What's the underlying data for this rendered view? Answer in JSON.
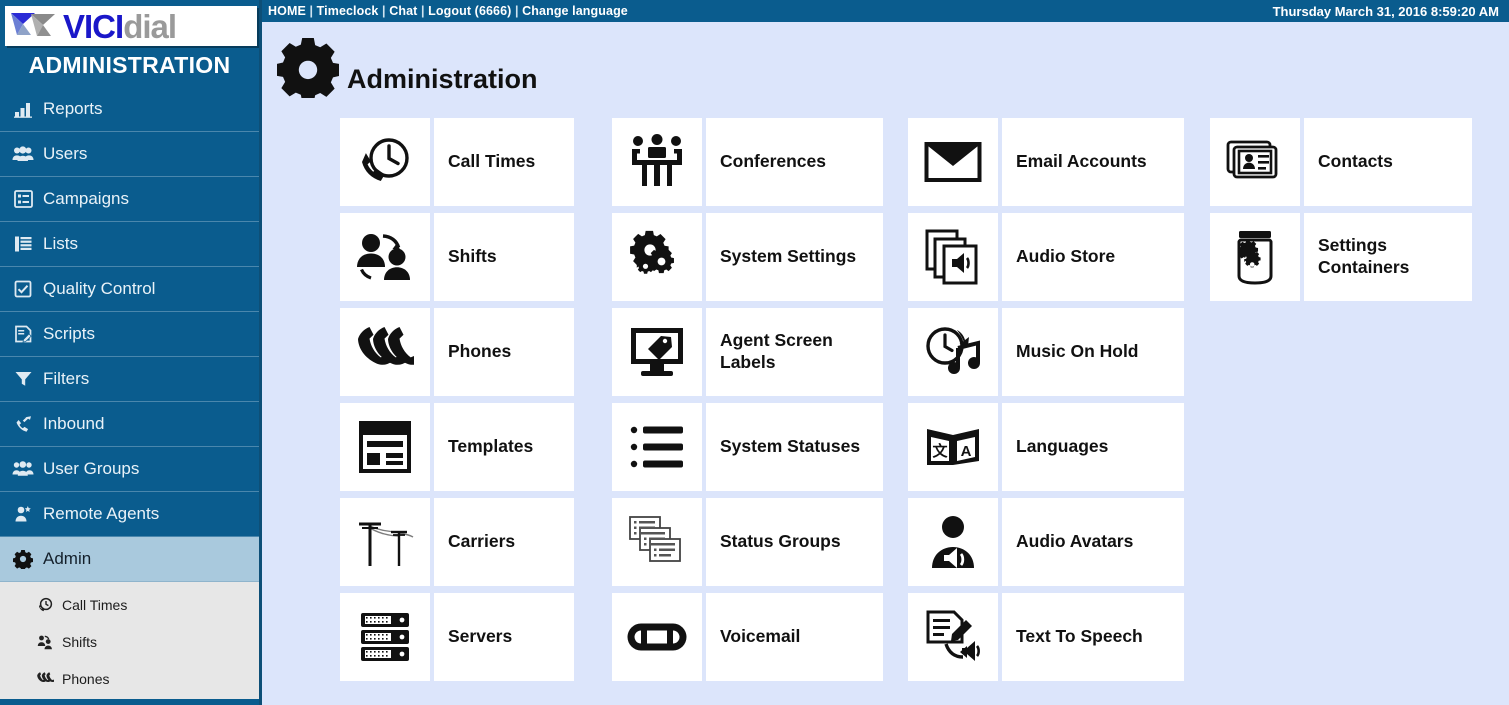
{
  "topbar": {
    "links": [
      "HOME",
      "Timeclock",
      "Chat",
      "Logout (6666)",
      "Change language"
    ],
    "separator": "|",
    "datetime": "Thursday March 31, 2016 8:59:20 AM"
  },
  "sidebar": {
    "logo": {
      "part1": "VICI",
      "part2": "dial",
      "icon": "vicidial-logo-icon"
    },
    "title": "ADMINISTRATION",
    "items": [
      {
        "label": "Reports",
        "icon": "reports-icon",
        "active": false
      },
      {
        "label": "Users",
        "icon": "users-icon",
        "active": false
      },
      {
        "label": "Campaigns",
        "icon": "campaigns-icon",
        "active": false
      },
      {
        "label": "Lists",
        "icon": "lists-icon",
        "active": false
      },
      {
        "label": "Quality Control",
        "icon": "quality-control-icon",
        "active": false
      },
      {
        "label": "Scripts",
        "icon": "scripts-icon",
        "active": false
      },
      {
        "label": "Filters",
        "icon": "filters-icon",
        "active": false
      },
      {
        "label": "Inbound",
        "icon": "inbound-icon",
        "active": false
      },
      {
        "label": "User Groups",
        "icon": "user-groups-icon",
        "active": false
      },
      {
        "label": "Remote Agents",
        "icon": "remote-agents-icon",
        "active": false
      },
      {
        "label": "Admin",
        "icon": "admin-gear-icon",
        "active": true
      }
    ],
    "submenu": [
      {
        "label": "Call Times",
        "icon": "call-times-icon"
      },
      {
        "label": "Shifts",
        "icon": "shifts-icon"
      },
      {
        "label": "Phones",
        "icon": "phones-icon"
      }
    ]
  },
  "main": {
    "title": "Administration",
    "title_icon": "gear-icon",
    "columns": [
      [
        {
          "label": "Call Times",
          "icon": "call-times-icon"
        },
        {
          "label": "Shifts",
          "icon": "shifts-icon"
        },
        {
          "label": "Phones",
          "icon": "phones-icon"
        },
        {
          "label": "Templates",
          "icon": "templates-icon"
        },
        {
          "label": "Carriers",
          "icon": "carriers-icon"
        },
        {
          "label": "Servers",
          "icon": "servers-icon"
        }
      ],
      [
        {
          "label": "Conferences",
          "icon": "conferences-icon"
        },
        {
          "label": "System Settings",
          "icon": "system-settings-icon"
        },
        {
          "label": "Agent Screen Labels",
          "icon": "agent-screen-labels-icon"
        },
        {
          "label": "System Statuses",
          "icon": "system-statuses-icon"
        },
        {
          "label": "Status Groups",
          "icon": "status-groups-icon"
        },
        {
          "label": "Voicemail",
          "icon": "voicemail-icon"
        }
      ],
      [
        {
          "label": "Email Accounts",
          "icon": "email-accounts-icon"
        },
        {
          "label": "Audio Store",
          "icon": "audio-store-icon"
        },
        {
          "label": "Music On Hold",
          "icon": "music-on-hold-icon"
        },
        {
          "label": "Languages",
          "icon": "languages-icon"
        },
        {
          "label": "Audio Avatars",
          "icon": "audio-avatars-icon"
        },
        {
          "label": "Text To Speech",
          "icon": "text-to-speech-icon"
        }
      ],
      [
        {
          "label": "Contacts",
          "icon": "contacts-icon"
        },
        {
          "label": "Settings Containers",
          "icon": "settings-containers-icon"
        }
      ]
    ]
  },
  "colors": {
    "sidebar_bg": "#0a5c8e",
    "topbar_bg": "#0a5c8e",
    "content_bg": "#dce5fb",
    "active_item_bg": "#a9c9dd",
    "submenu_bg": "#e7e7e7",
    "tile_bg": "#ffffff"
  }
}
